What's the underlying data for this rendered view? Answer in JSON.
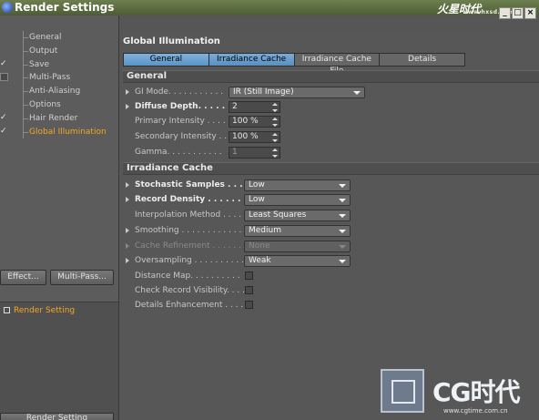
{
  "window": {
    "title": "Render Settings",
    "watermark_top": "火星时代",
    "watermark_top_url": "www.hxsd.com",
    "controls": [
      "_",
      "□",
      "×"
    ]
  },
  "left": {
    "tree": [
      {
        "label": "General",
        "check": "",
        "active": false
      },
      {
        "label": "Output",
        "check": "",
        "active": false
      },
      {
        "label": "Save",
        "check": "✓",
        "active": false
      },
      {
        "label": "Multi-Pass",
        "check": "box",
        "active": false
      },
      {
        "label": "Anti-Aliasing",
        "check": "",
        "active": false
      },
      {
        "label": "Options",
        "check": "",
        "active": false
      },
      {
        "label": "Hair Render",
        "check": "✓",
        "active": false
      },
      {
        "label": "Global Illumination",
        "check": "✓",
        "active": true
      }
    ],
    "effect_button": "Effect...",
    "multipass_button": "Multi-Pass...",
    "render_setting_item": "Render Setting",
    "bottom_button": "Render Setting"
  },
  "right": {
    "section_title": "Global Illumination",
    "tabs": [
      "General",
      "Irradiance Cache",
      "Irradiance Cache File",
      "Details"
    ],
    "general_header": "General",
    "gi_mode_label": "GI Mode. . . . . . . . . . .",
    "gi_mode_value": "IR (Still Image)",
    "diffuse_depth_label": "Diffuse Depth. . . . . .",
    "diffuse_depth_value": "2",
    "primary_intensity_label": "Primary Intensity . . . . .",
    "primary_intensity_value": "100 %",
    "secondary_intensity_label": "Secondary Intensity . . .",
    "secondary_intensity_value": "100 %",
    "gamma_label": "Gamma. . . . . . . . . . .",
    "gamma_value": "1",
    "irr_header": "Irradiance Cache",
    "stochastic_label": "Stochastic Samples . . .",
    "stochastic_value": "Low",
    "record_density_label": "Record Density . . . . . .",
    "record_density_value": "Low",
    "interp_label": "Interpolation Method . . . .",
    "interp_value": "Least Squares",
    "smoothing_label": "Smoothing . . . . . . . . . . . .",
    "smoothing_value": "Medium",
    "cache_refinement_label": "Cache Refinement . . . . . .",
    "cache_refinement_value": "None",
    "oversampling_label": "Oversampling . . . . . . . . . .",
    "oversampling_value": "Weak",
    "distance_map_label": "Distance Map. . . . . . . . . .",
    "check_record_label": "Check Record Visibility. . . .",
    "details_enh_label": "Details Enhancement . . . . ."
  },
  "watermark": {
    "brand": "CG时代",
    "url": "www.cgtime.com.cn"
  }
}
